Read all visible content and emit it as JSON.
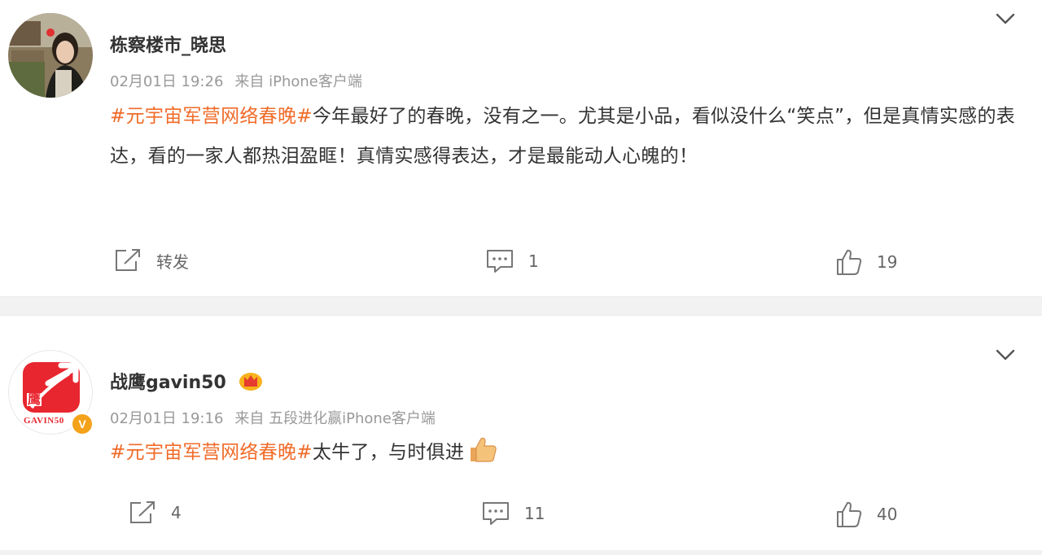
{
  "posts": [
    {
      "username": "栋察楼市_晓思",
      "date": "02月01日 19:26",
      "source": "来自 iPhone客户端",
      "topic": "#元宇宙军营网络春晚#",
      "text": "今年最好了的春晚，没有之一。尤其是小品，看似没什么“笑点”，但是真情实感的表达，看的一家人都热泪盈眶！真情实感得表达，才是最能动人心魄的！",
      "repost_label": "转发",
      "comment_count": "1",
      "like_count": "19",
      "avatar_icon": "user-photo-avatar",
      "more_icon": "chevron-down-icon"
    },
    {
      "username": "战鹰gavin50",
      "date": "02月01日 19:16",
      "source": "来自 五段进化赢iPhone客户端",
      "topic": "#元宇宙军营网络春晚#",
      "text": "太牛了，与时俱进",
      "repost_count": "4",
      "comment_count": "11",
      "like_count": "40",
      "avatar_logo_text": "鹰",
      "avatar_caption": "GAVIN50",
      "verified_badge": "V",
      "badge_icon": "crown-icon",
      "emoji_icon": "thumbs-up-emoji",
      "more_icon": "chevron-down-icon"
    }
  ],
  "colors": {
    "topic": "#f06b28",
    "meta": "#999999",
    "separator": "#f2f2f2",
    "logo_red": "#e8262f",
    "verified": "#f4a21a"
  }
}
